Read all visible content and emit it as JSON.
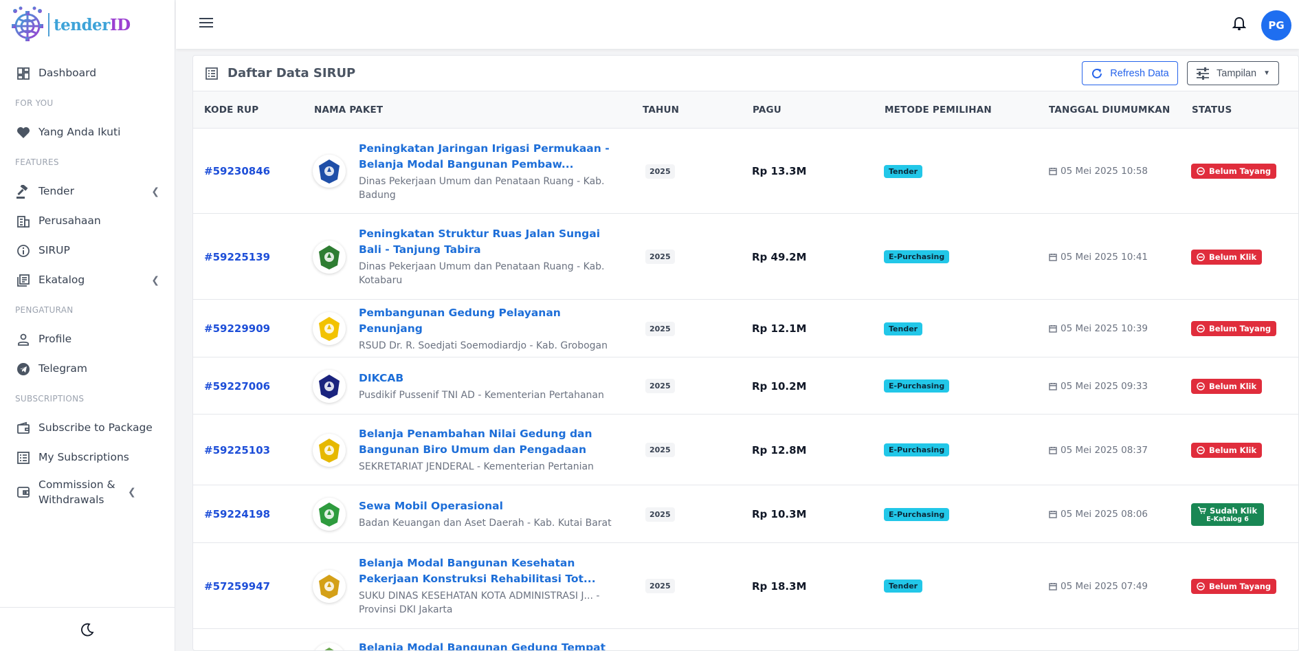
{
  "brand": {
    "part1": "tender",
    "part2": "ID"
  },
  "sidebar": {
    "items": [
      {
        "label": "Dashboard"
      },
      {
        "section": "FOR YOU"
      },
      {
        "label": "Yang Anda Ikuti"
      },
      {
        "section": "FEATURES"
      },
      {
        "label": "Tender"
      },
      {
        "label": "Perusahaan"
      },
      {
        "label": "SIRUP"
      },
      {
        "label": "Ekatalog"
      },
      {
        "section": "PENGATURAN"
      },
      {
        "label": "Profile"
      },
      {
        "label": "Telegram"
      },
      {
        "section": "SUBSCRIPTIONS"
      },
      {
        "label": "Subscribe to Package"
      },
      {
        "label": "My Subscriptions"
      },
      {
        "label": "Commission & Withdrawals"
      }
    ]
  },
  "topbar": {
    "avatar_initials": "PG"
  },
  "card": {
    "title": "Daftar Data SIRUP",
    "refresh_label": "Refresh Data",
    "view_label": "Tampilan"
  },
  "table": {
    "headers": [
      "KODE RUP",
      "NAMA PAKET",
      "TAHUN",
      "PAGU",
      "METODE PEMILIHAN",
      "TANGGAL DIUMUMKAN",
      "STATUS"
    ],
    "rows": [
      {
        "kode": "#59230846",
        "name": "Peningkatan Jaringan Irigasi Permukaan - Belanja Modal Bangunan Pembaw...",
        "agency": "Dinas Pekerjaan Umum dan Penataan Ruang - Kab. Badung",
        "tahun": "2025",
        "pagu": "Rp 13.3M",
        "metode": "Tender",
        "tanggal": "05 Mei 2025 10:58",
        "status": "Belum Tayang",
        "status_sub": "",
        "logo_color": "#1f4fa8"
      },
      {
        "kode": "#59225139",
        "name": "Peningkatan Struktur Ruas Jalan Sungai Bali - Tanjung Tabira",
        "agency": "Dinas Pekerjaan Umum dan Penataan Ruang - Kab. Kotabaru",
        "tahun": "2025",
        "pagu": "Rp 49.2M",
        "metode": "E-Purchasing",
        "tanggal": "05 Mei 2025 10:41",
        "status": "Belum Klik",
        "status_sub": "",
        "logo_color": "#2e7d32"
      },
      {
        "kode": "#59229909",
        "name": "Pembangunan Gedung Pelayanan Penunjang",
        "agency": "RSUD Dr. R. Soedjati Soemodiardjo - Kab. Grobogan",
        "tahun": "2025",
        "pagu": "Rp 12.1M",
        "metode": "Tender",
        "tanggal": "05 Mei 2025 10:39",
        "status": "Belum Tayang",
        "status_sub": "",
        "logo_color": "#f2c200"
      },
      {
        "kode": "#59227006",
        "name": "DIKCAB",
        "agency": "Pusdikif Pussenif TNI AD - Kementerian Pertahanan",
        "tahun": "2025",
        "pagu": "Rp 10.2M",
        "metode": "E-Purchasing",
        "tanggal": "05 Mei 2025 09:33",
        "status": "Belum Klik",
        "status_sub": "",
        "logo_color": "#1a237e"
      },
      {
        "kode": "#59225103",
        "name": "Belanja Penambahan Nilai Gedung dan Bangunan Biro Umum dan Pengadaan",
        "agency": "SEKRETARIAT JENDERAL - Kementerian Pertanian",
        "tahun": "2025",
        "pagu": "Rp 12.8M",
        "metode": "E-Purchasing",
        "tanggal": "05 Mei 2025 08:37",
        "status": "Belum Klik",
        "status_sub": "",
        "logo_color": "#e6b800"
      },
      {
        "kode": "#59224198",
        "name": "Sewa Mobil Operasional",
        "agency": "Badan Keuangan dan Aset Daerah - Kab. Kutai Barat",
        "tahun": "2025",
        "pagu": "Rp 10.3M",
        "metode": "E-Purchasing",
        "tanggal": "05 Mei 2025 08:06",
        "status": "Sudah Klik",
        "status_sub": "E-Katalog 6",
        "logo_color": "#2e9b3e"
      },
      {
        "kode": "#57259947",
        "name": "Belanja Modal Bangunan Kesehatan Pekerjaan Konstruksi Rehabilitasi Tot...",
        "agency": "SUKU DINAS KESEHATAN KOTA ADMINISTRASI J... - Provinsi DKI Jakarta",
        "tahun": "2025",
        "pagu": "Rp 18.3M",
        "metode": "Tender",
        "tanggal": "05 Mei 2025 07:49",
        "status": "Belum Tayang",
        "status_sub": "",
        "logo_color": "#d4a017"
      },
      {
        "kode": "",
        "name": "Belanja Modal Bangunan Gedung Tempat",
        "agency": "",
        "tahun": "",
        "pagu": "",
        "metode": "",
        "tanggal": "",
        "status": "",
        "status_sub": "",
        "logo_color": "#6aa84f"
      }
    ]
  },
  "colors": {
    "link": "#1d6ed8",
    "status_red": "#e02d3c",
    "status_green": "#198754",
    "metode_badge": "#22c7e8",
    "avatar": "#1e6ef0"
  }
}
